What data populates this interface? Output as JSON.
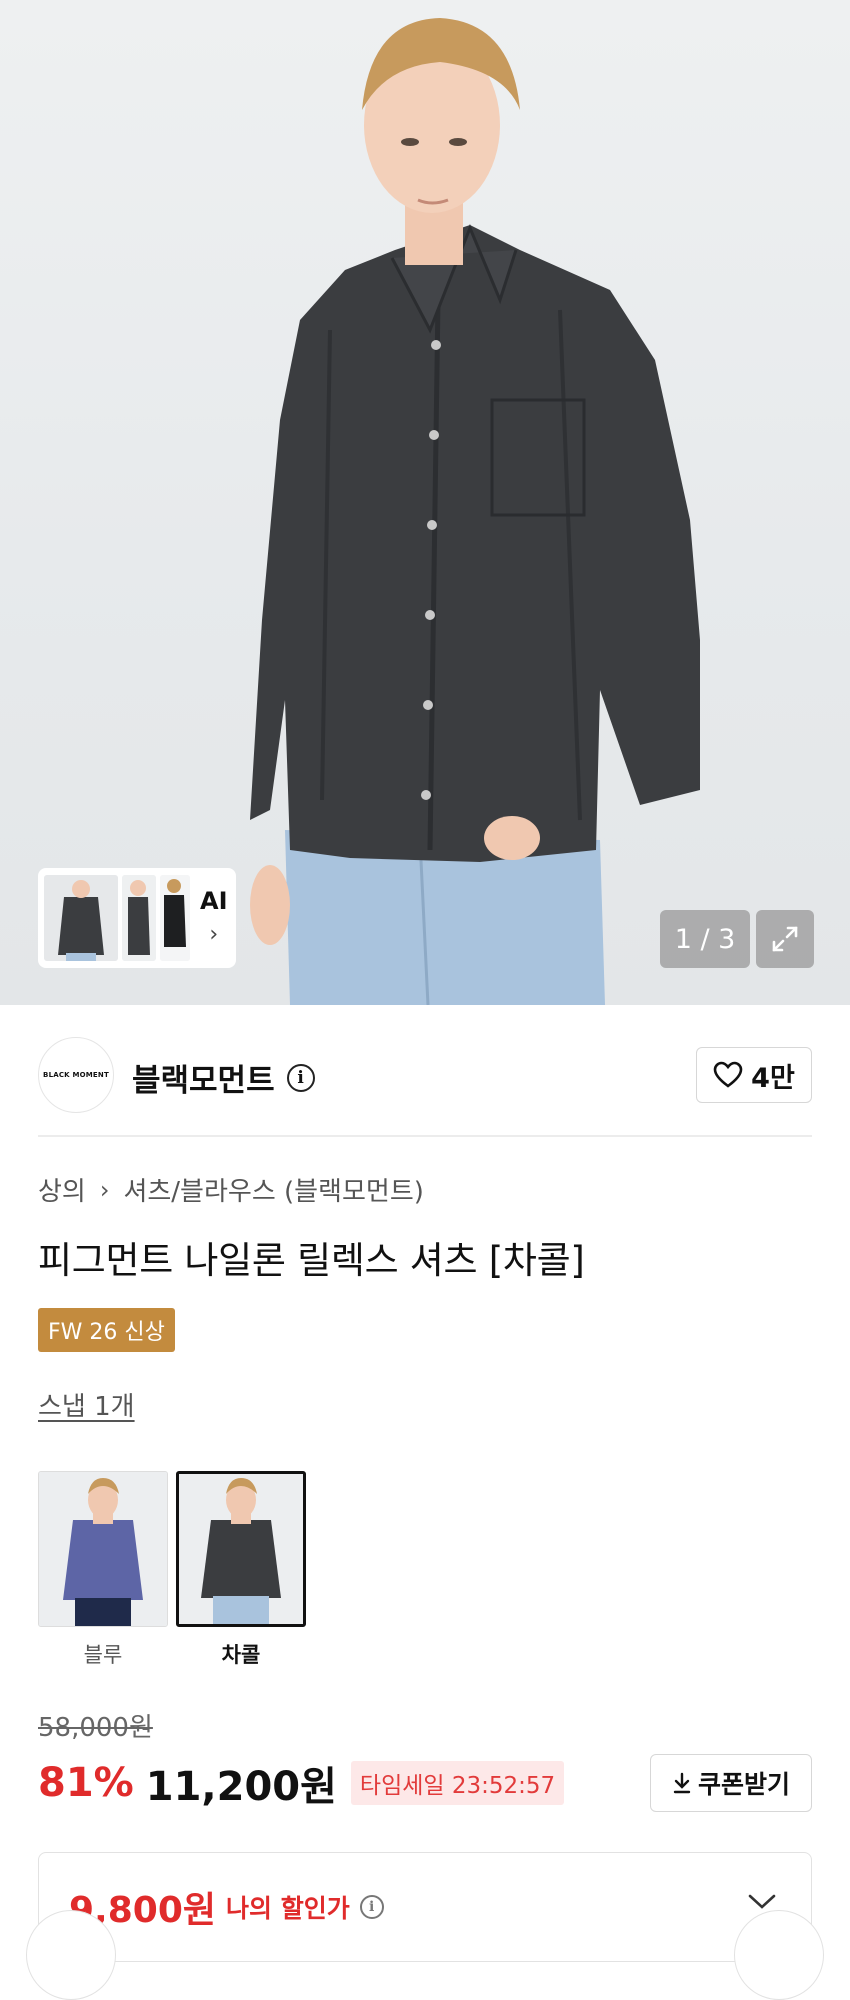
{
  "gallery": {
    "counter": "1 / 3",
    "ai_label": "AI",
    "ai_chevron": "›"
  },
  "brand": {
    "logo_text": "BLACK MOMENT",
    "name": "블랙모먼트",
    "info_icon": "i",
    "likes": "4만"
  },
  "breadcrumb": {
    "category": "상의",
    "separator": "›",
    "subcategory": "셔츠/블라우스 (블랙모먼트)"
  },
  "product": {
    "title": "피그먼트 나일론 릴렉스 셔츠 [차콜]",
    "badge": "FW 26 신상",
    "snap_link": "스냅 1개"
  },
  "colors": [
    {
      "label": "블루",
      "selected": false,
      "shirt": "#5d65a6"
    },
    {
      "label": "차콜",
      "selected": true,
      "shirt": "#3b3d40"
    }
  ],
  "pricing": {
    "original": "58,000원",
    "discount": "81%",
    "price": "11,200원",
    "timesale": "타임세일 23:52:57",
    "coupon_label": "쿠폰받기",
    "my_price": "9,800원",
    "my_price_label": "나의 할인가"
  },
  "theme": {
    "sale_red": "#e02b2b",
    "badge_gold": "#c38b3e",
    "timesale_bg": "#fde8e8"
  }
}
